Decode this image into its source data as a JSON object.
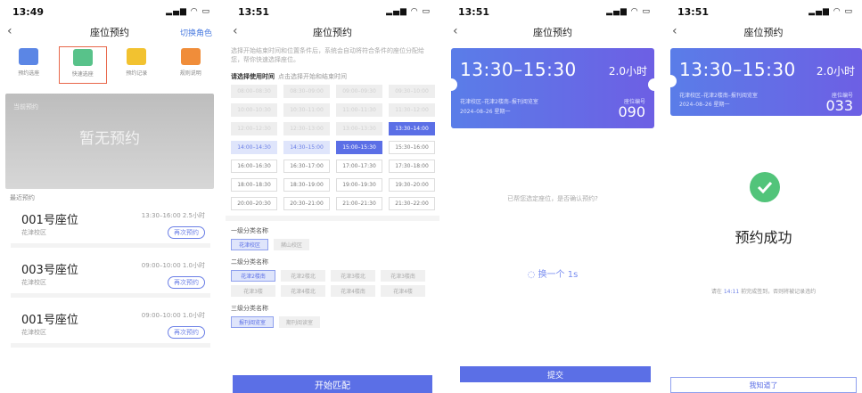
{
  "p1": {
    "time": "13:49",
    "title": "座位预约",
    "switch": "切换角色",
    "tiles": [
      {
        "label": "预约选座",
        "icon": "seat-calendar-icon",
        "color": "#5b86e5"
      },
      {
        "label": "快速选座",
        "icon": "seat-lightning-icon",
        "color": "#58c28a"
      },
      {
        "label": "预约记录",
        "icon": "record-icon",
        "color": "#f2c230"
      },
      {
        "label": "规则说明",
        "icon": "rules-icon",
        "color": "#f08d3a"
      }
    ],
    "current_label": "当前预约",
    "current_empty": "暂无预约",
    "recent_label": "最近预约",
    "recent": [
      {
        "seat": "001号座位",
        "time": "13:30–16:00  2.5小时",
        "loc": "花津校区",
        "btn": "再次预约"
      },
      {
        "seat": "003号座位",
        "time": "09:00–10:00  1.0小时",
        "loc": "花津校区",
        "btn": "再次预约"
      },
      {
        "seat": "001号座位",
        "time": "09:00–10:00  1.0小时",
        "loc": "花津校区",
        "btn": "再次预约"
      }
    ]
  },
  "p2": {
    "time": "13:51",
    "title": "座位预约",
    "hint": "选择开始结束时间和位置条件后，系统会自动将符合条件的座位分配给您，帮你快速选择座位。",
    "sec_title": "请选择使用时间",
    "sec_sub": "点击选择开始和结束时间",
    "slots": [
      {
        "t": "08:00–08:30",
        "s": "dis"
      },
      {
        "t": "08:30–09:00",
        "s": "dis"
      },
      {
        "t": "09:00–09:30",
        "s": "dis"
      },
      {
        "t": "09:30–10:00",
        "s": "dis"
      },
      {
        "t": "10:00–10:30",
        "s": "dis"
      },
      {
        "t": "10:30–11:00",
        "s": "dis"
      },
      {
        "t": "11:00–11:30",
        "s": "dis"
      },
      {
        "t": "11:30–12:00",
        "s": "dis"
      },
      {
        "t": "12:00–12:30",
        "s": "dis"
      },
      {
        "t": "12:30–13:00",
        "s": "dis"
      },
      {
        "t": "13:00–13:30",
        "s": "dis"
      },
      {
        "t": "13:30–14:00",
        "s": "ends"
      },
      {
        "t": "14:00–14:30",
        "s": "rng"
      },
      {
        "t": "14:30–15:00",
        "s": "rng"
      },
      {
        "t": "15:00–15:30",
        "s": "ends"
      },
      {
        "t": "15:30–16:00",
        "s": ""
      },
      {
        "t": "16:00–16:30",
        "s": ""
      },
      {
        "t": "16:30–17:00",
        "s": ""
      },
      {
        "t": "17:00–17:30",
        "s": ""
      },
      {
        "t": "17:30–18:00",
        "s": ""
      },
      {
        "t": "18:00–18:30",
        "s": ""
      },
      {
        "t": "18:30–19:00",
        "s": ""
      },
      {
        "t": "19:00–19:30",
        "s": ""
      },
      {
        "t": "19:30–20:00",
        "s": ""
      },
      {
        "t": "20:00–20:30",
        "s": ""
      },
      {
        "t": "20:30–21:00",
        "s": ""
      },
      {
        "t": "21:00–21:30",
        "s": ""
      },
      {
        "t": "21:30–22:00",
        "s": ""
      }
    ],
    "cat1": {
      "title": "一级分类名称",
      "chips": [
        {
          "t": "花津校区",
          "on": true
        },
        {
          "t": "赭山校区",
          "on": false
        }
      ]
    },
    "cat2": {
      "title": "二级分类名称",
      "chips": [
        {
          "t": "花津2楼南",
          "on": true
        },
        {
          "t": "花津2楼北",
          "on": false
        },
        {
          "t": "花津3楼北",
          "on": false
        },
        {
          "t": "花津3楼南",
          "on": false
        },
        {
          "t": "花津3楼",
          "on": false
        },
        {
          "t": "花津4楼北",
          "on": false
        },
        {
          "t": "花津4楼南",
          "on": false
        },
        {
          "t": "花津4楼",
          "on": false
        }
      ]
    },
    "cat3": {
      "title": "三级分类名称",
      "chips": [
        {
          "t": "报刊阅览室",
          "on": true
        },
        {
          "t": "期刊阅读室",
          "on": false
        }
      ]
    },
    "start_btn": "开始匹配"
  },
  "p3": {
    "time": "13:51",
    "title": "座位预约",
    "ticket": {
      "time": "13:30–15:30",
      "dur": "2.0小时",
      "loc": "花津校区–花津2楼南–报刊阅览室",
      "date": "2024–08–26 星期一",
      "seat_label": "座位编号",
      "seat_no": "090"
    },
    "confirm": "已帮您选定座位，是否确认预约?",
    "loading": "换一个 1s",
    "submit": "提交"
  },
  "p4": {
    "time": "13:51",
    "title": "座位预约",
    "ticket": {
      "time": "13:30–15:30",
      "dur": "2.0小时",
      "loc": "花津校区–花津2楼南–报刊阅览室",
      "date": "2024–08–26 星期一",
      "seat_label": "座位编号",
      "seat_no": "033"
    },
    "success": "预约成功",
    "note_pre": "请在",
    "note_time": "14:11",
    "note_post": "前完成签到，否则将被记录违约",
    "gotit": "我知道了"
  },
  "colors": {
    "accent": "#5b6fe6",
    "success": "#52c47a",
    "highlight": "#e8674a"
  }
}
